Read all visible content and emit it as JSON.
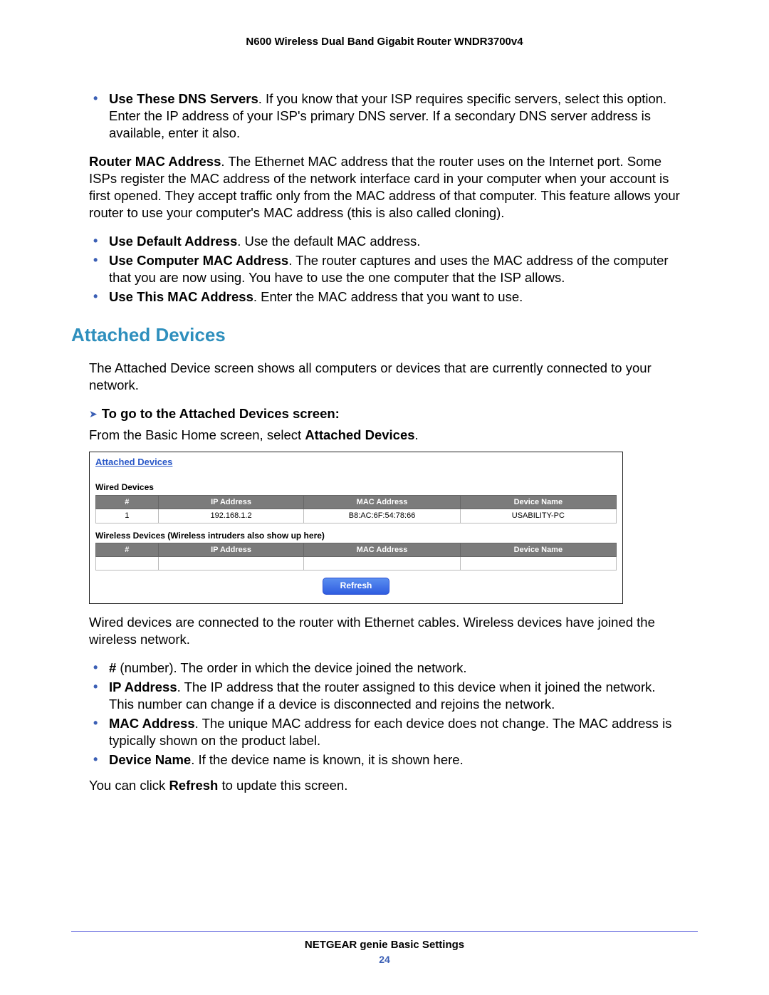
{
  "header": {
    "title": "N600 Wireless Dual Band Gigabit Router WNDR3700v4"
  },
  "top_bullets": [
    {
      "bold": "Use These DNS Servers",
      "text": ". If you know that your ISP requires specific servers, select this option. Enter the IP address of your ISP's primary DNS server. If a secondary DNS server address is available, enter it also."
    }
  ],
  "mac_para": {
    "bold": "Router MAC Address",
    "text": ". The Ethernet MAC address that the router uses on the Internet port. Some ISPs register the MAC address of the network interface card in your computer when your account is first opened. They accept traffic only from the MAC address of that computer. This feature allows your router to use your computer's MAC address (this is also called cloning)."
  },
  "mac_bullets": [
    {
      "bold": "Use Default Address",
      "text": ". Use the default MAC address."
    },
    {
      "bold": "Use Computer MAC Address",
      "text": ". The router captures and uses the MAC address of the computer that you are now using. You have to use the one computer that the ISP allows."
    },
    {
      "bold": "Use This MAC Address",
      "text": ". Enter the MAC address that you want to use."
    }
  ],
  "section": {
    "heading": "Attached Devices",
    "intro": "The Attached Device screen shows all computers or devices that are currently connected to your network."
  },
  "step": {
    "heading": "To go to the Attached Devices screen:",
    "line_pre": "From the Basic Home screen, select ",
    "line_bold": "Attached Devices",
    "line_post": "."
  },
  "screenshot": {
    "title": "Attached Devices",
    "wired_label": "Wired Devices",
    "cols": {
      "num": "#",
      "ip": "IP Address",
      "mac": "MAC Address",
      "name": "Device Name"
    },
    "wired_rows": [
      {
        "num": "1",
        "ip": "192.168.1.2",
        "mac": "B8:AC:6F:54:78:66",
        "name": "USABILITY-PC"
      }
    ],
    "wireless_label": "Wireless Devices (Wireless intruders also show up here)",
    "refresh": "Refresh"
  },
  "after_screenshot": "Wired devices are connected to the router with Ethernet cables. Wireless devices have joined the wireless network.",
  "field_bullets": [
    {
      "bold": "#",
      "text": " (number). The order in which the device joined the network."
    },
    {
      "bold": "IP Address",
      "text": ". The IP address that the router assigned to this device when it joined the network. This number can change if a device is disconnected and rejoins the network."
    },
    {
      "bold": "MAC Address",
      "text": ". The unique MAC address for each device does not change. The MAC address is typically shown on the product label."
    },
    {
      "bold": "Device Name",
      "text": ". If the device name is known, it is shown here."
    }
  ],
  "refresh_line": {
    "pre": "You can click ",
    "bold": "Refresh",
    "post": " to update this screen."
  },
  "footer": {
    "title": "NETGEAR genie Basic Settings",
    "page": "24"
  }
}
